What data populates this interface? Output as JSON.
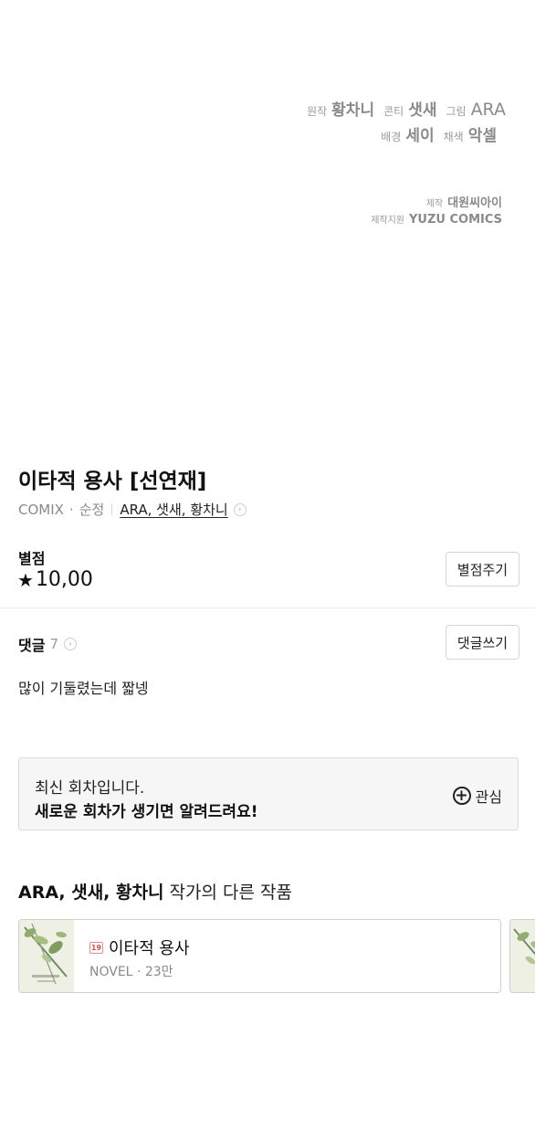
{
  "credits": {
    "original_role": "원작",
    "original_name": "황차니",
    "conti_role": "콘티",
    "conti_name": "샛새",
    "art_role": "그림",
    "art_name": "ARA",
    "background_role": "배경",
    "background_name": "세이",
    "coloring_role": "채색",
    "coloring_name": "악셀",
    "production_role": "제작",
    "production_name": "대원씨아이",
    "support_role": "제작지원",
    "support_name": "YUZU COMICS"
  },
  "work": {
    "title": "이타적 용사 [선연재]",
    "category": "COMIX",
    "dot": "·",
    "genre": "순정",
    "authors": "ARA, 샛새, 황차니"
  },
  "rating": {
    "label": "별점",
    "star": "★",
    "value": "10,00",
    "button": "별점주기"
  },
  "comments": {
    "label": "댓글",
    "count": "7",
    "button": "댓글쓰기",
    "latest": "많이 기둘렸는데 짧넹"
  },
  "notice": {
    "line1": "최신 회차입니다.",
    "line2": "새로운 회차가 생기면 알려드려요!",
    "follow_label": "관심",
    "follow_icon": "plus-circle-icon"
  },
  "other_works": {
    "authors": "ARA, 샛새, 황차니",
    "suffix": " 작가의 다른 작품",
    "items": [
      {
        "age_badge": "19",
        "title": "이타적 용사",
        "type": "NOVEL",
        "dot": "·",
        "views": "23만"
      }
    ]
  }
}
